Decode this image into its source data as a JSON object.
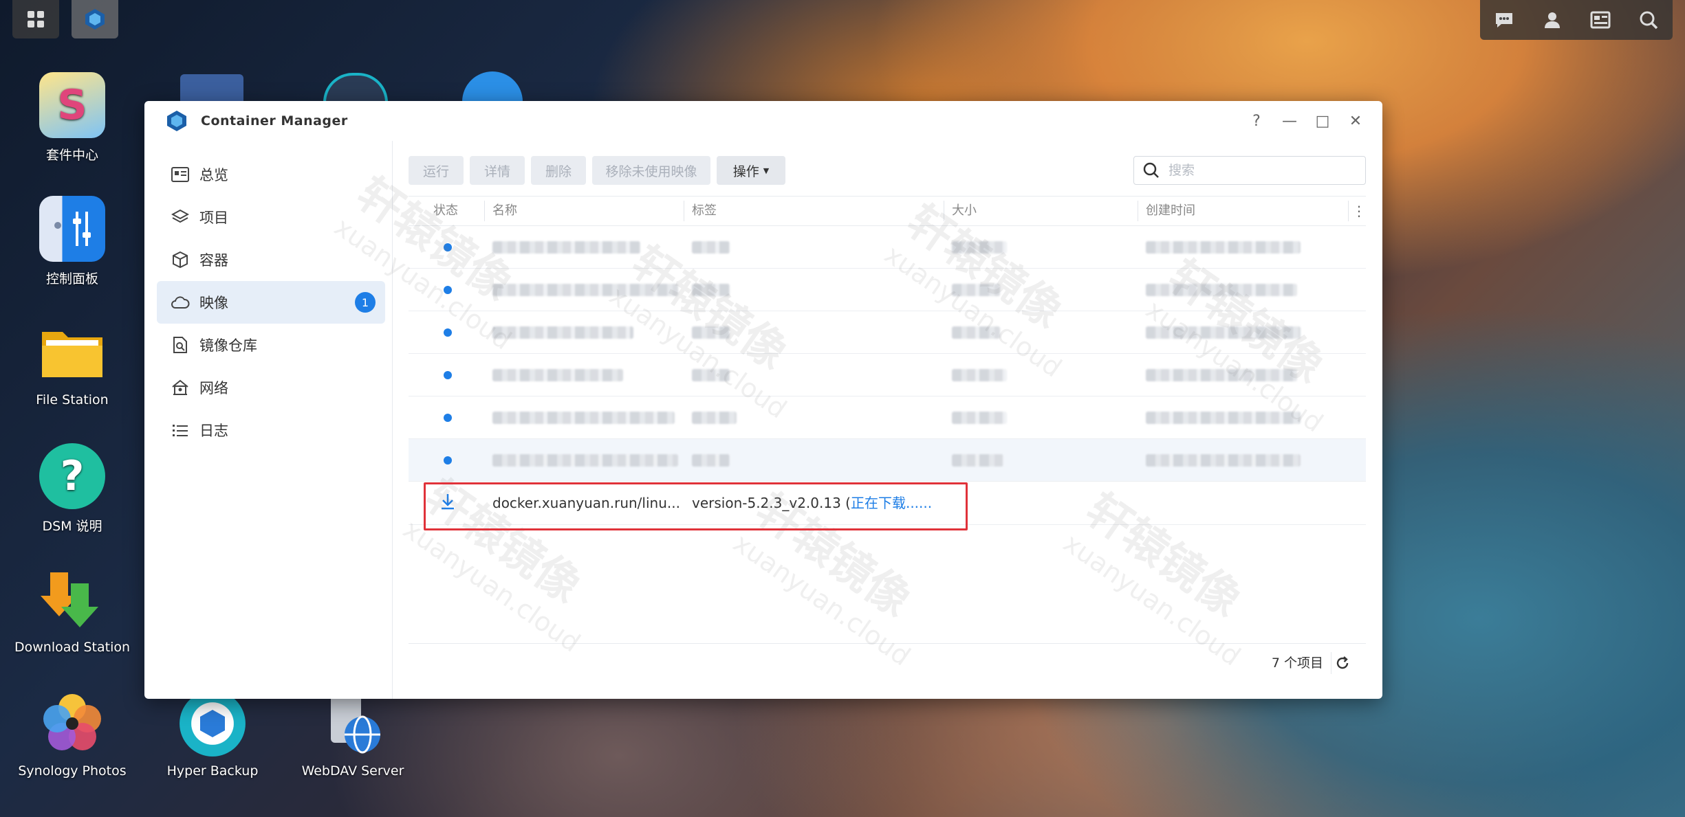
{
  "window": {
    "title": "Container Manager",
    "help": "?",
    "minimize": "—",
    "maximize": "□",
    "close": "✕"
  },
  "desktop": {
    "icons": [
      {
        "label": "套件中心"
      },
      {
        "label": "控制面板"
      },
      {
        "label": "File Station"
      },
      {
        "label": "DSM 说明"
      },
      {
        "label": "Download Station"
      },
      {
        "label": "Synology Photos"
      },
      {
        "label": "Hyper Backup"
      },
      {
        "label": "WebDAV Server"
      }
    ]
  },
  "sidebar": {
    "items": [
      {
        "label": "总览"
      },
      {
        "label": "项目"
      },
      {
        "label": "容器"
      },
      {
        "label": "映像",
        "badge": "1"
      },
      {
        "label": "镜像仓库"
      },
      {
        "label": "网络"
      },
      {
        "label": "日志"
      }
    ]
  },
  "toolbar": {
    "run": "运行",
    "details": "详情",
    "delete": "删除",
    "remove_unused": "移除未使用映像",
    "actions": "操作",
    "search_placeholder": "搜索"
  },
  "table": {
    "columns": [
      "状态",
      "名称",
      "标签",
      "大小",
      "创建时间"
    ],
    "download_row": {
      "name": "docker.xuanyuan.run/linu...",
      "tag": "version-5.2.3_v2.0.13 (",
      "status": "正在下载......"
    }
  },
  "footer": {
    "count": "7 个项目"
  },
  "watermark": {
    "text": "轩辕镜像",
    "sub": "xuanyuan.cloud"
  },
  "colors": {
    "accent": "#1e7ee6",
    "highlight_box": "#e0323a"
  }
}
